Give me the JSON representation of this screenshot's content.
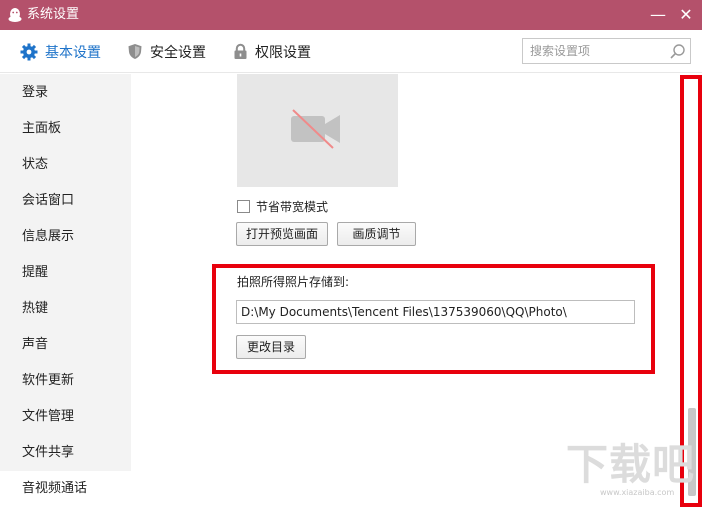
{
  "window": {
    "title": "系统设置",
    "title_bar_color": "#b4516b",
    "minimize_glyph": "—",
    "close_glyph": "✕"
  },
  "tabs": [
    {
      "label": "基本设置",
      "icon": "gear-icon",
      "active": true
    },
    {
      "label": "安全设置",
      "icon": "shield-icon",
      "active": false
    },
    {
      "label": "权限设置",
      "icon": "lock-icon",
      "active": false
    }
  ],
  "search": {
    "placeholder": "搜索设置项",
    "value": ""
  },
  "sidebar": {
    "items": [
      {
        "label": "登录"
      },
      {
        "label": "主面板"
      },
      {
        "label": "状态"
      },
      {
        "label": "会话窗口"
      },
      {
        "label": "信息展示"
      },
      {
        "label": "提醒"
      },
      {
        "label": "热键"
      },
      {
        "label": "声音"
      },
      {
        "label": "软件更新"
      },
      {
        "label": "文件管理"
      },
      {
        "label": "文件共享"
      },
      {
        "label": "音视频通话",
        "active": true
      }
    ]
  },
  "video": {
    "camera_icon": "camera-off-icon",
    "bandwidth_saving_label": "节省带宽模式",
    "bandwidth_saving_checked": false,
    "open_preview_button": "打开预览画面",
    "quality_button": "画质调节"
  },
  "photo": {
    "label": "拍照所得照片存储到:",
    "path": "D:\\My Documents\\Tencent Files\\137539060\\QQ\\Photo\\",
    "change_button": "更改目录"
  },
  "accent_color": "#1e73c9",
  "highlight_color": "#e8000d",
  "watermark": {
    "big": "下载吧",
    "url": "www.xiazaiba.com"
  }
}
